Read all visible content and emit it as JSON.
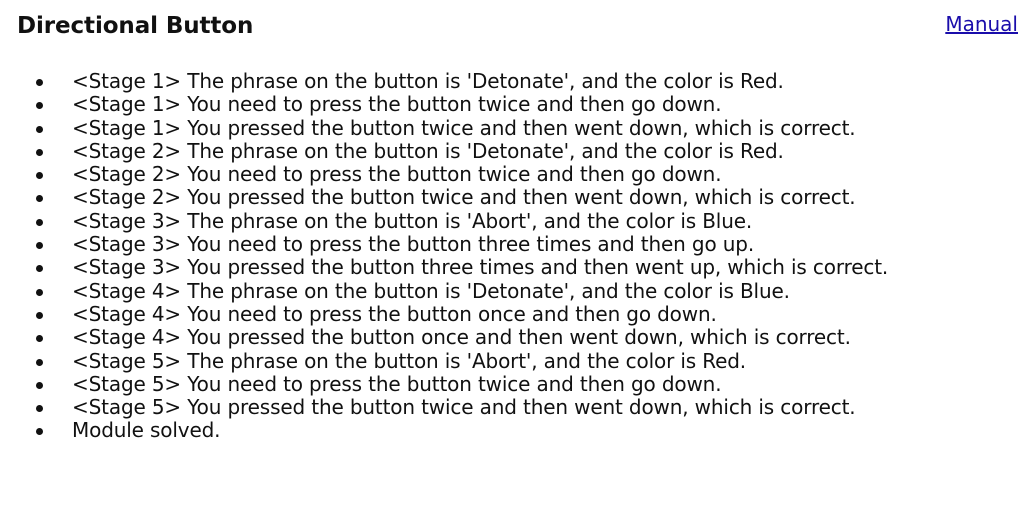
{
  "header": {
    "title": "Directional Button",
    "manual_link": "Manual"
  },
  "log": [
    "<Stage 1> The phrase on the button is 'Detonate', and the color is Red.",
    "<Stage 1> You need to press the button twice and then go down.",
    "<Stage 1> You pressed the button twice and then went down, which is correct.",
    "<Stage 2> The phrase on the button is 'Detonate', and the color is Red.",
    "<Stage 2> You need to press the button twice and then go down.",
    "<Stage 2> You pressed the button twice and then went down, which is correct.",
    "<Stage 3> The phrase on the button is 'Abort', and the color is Blue.",
    "<Stage 3> You need to press the button three times and then go up.",
    "<Stage 3> You pressed the button three times and then went up, which is correct.",
    "<Stage 4> The phrase on the button is 'Detonate', and the color is Blue.",
    "<Stage 4> You need to press the button once and then go down.",
    "<Stage 4> You pressed the button once and then went down, which is correct.",
    "<Stage 5> The phrase on the button is 'Abort', and the color is Red.",
    "<Stage 5> You need to press the button twice and then go down.",
    "<Stage 5> You pressed the button twice and then went down, which is correct.",
    "Module solved."
  ]
}
